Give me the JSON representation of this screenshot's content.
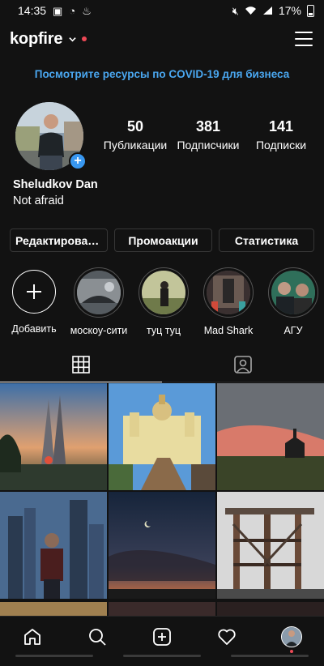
{
  "status_bar": {
    "time": "14:35",
    "battery": "17%"
  },
  "header": {
    "username": "kopfire"
  },
  "banner": {
    "text": "Посмотрите ресурсы по COVID-19 для бизнеса"
  },
  "profile": {
    "stats": [
      {
        "value": "50",
        "label": "Публикации"
      },
      {
        "value": "381",
        "label": "Подписчики"
      },
      {
        "value": "141",
        "label": "Подписки"
      }
    ],
    "name": "Sheludkov Dan",
    "bio": "Not afraid"
  },
  "actions": {
    "edit": "Редактировать профиль",
    "promo": "Промоакции",
    "stats": "Статистика"
  },
  "highlights": [
    {
      "label": "Добавить",
      "icon": "plus-icon"
    },
    {
      "label": "москоу-сити"
    },
    {
      "label": "туц туц"
    },
    {
      "label": "Mad Shark"
    },
    {
      "label": "АГУ"
    }
  ],
  "tabs": [
    {
      "icon": "grid-icon",
      "active": true
    },
    {
      "icon": "tagged-photos-icon",
      "active": false
    }
  ],
  "nav": {
    "items": [
      "home-icon",
      "search-icon",
      "new-post-icon",
      "activity-heart-icon",
      "profile-avatar"
    ]
  },
  "colors": {
    "background": "#121212",
    "link": "#4aa7f0",
    "notification": "#ed4956",
    "accent": "#3897f0"
  }
}
